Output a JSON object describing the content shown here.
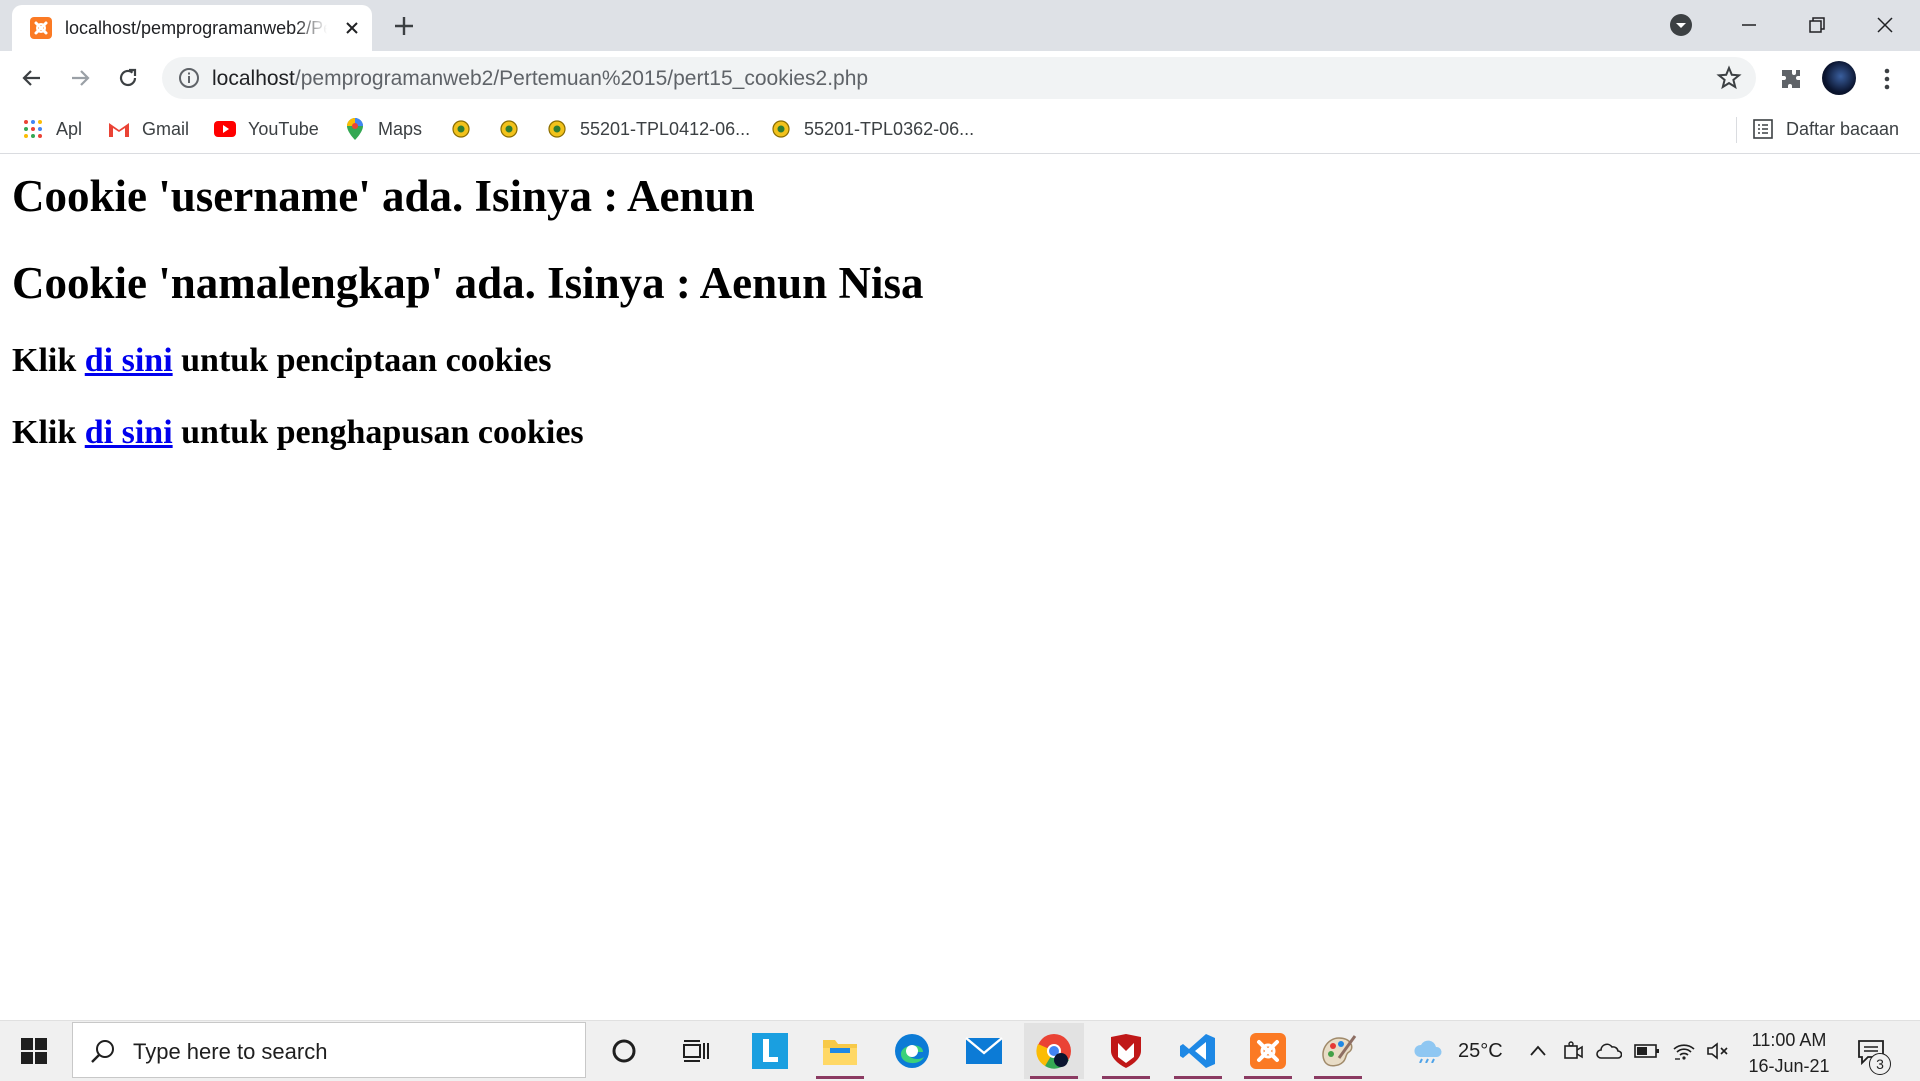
{
  "browser": {
    "tab": {
      "title": "localhost/pemprogramanweb2/Pertemuan%2015/pert15_cookies2.php"
    },
    "url": {
      "host": "localhost",
      "path": "/pemprogramanweb2/Pertemuan%2015/pert15_cookies2.php"
    },
    "bookmarks": [
      {
        "label": "Apl",
        "icon": "apps-grid-icon"
      },
      {
        "label": "Gmail",
        "icon": "gmail-icon"
      },
      {
        "label": "YouTube",
        "icon": "youtube-icon"
      },
      {
        "label": "Maps",
        "icon": "maps-pin-icon"
      },
      {
        "label": "",
        "icon": "site-logo-icon"
      },
      {
        "label": "",
        "icon": "site-logo-icon"
      },
      {
        "label": "55201-TPL0412-06...",
        "icon": "site-logo-icon"
      },
      {
        "label": "55201-TPL0362-06...",
        "icon": "site-logo-icon"
      }
    ],
    "reading_list": "Daftar bacaan"
  },
  "page": {
    "line1": "Cookie 'username' ada. Isinya : Aenun",
    "line2": "Cookie 'namalengkap' ada. Isinya : Aenun Nisa",
    "link_rows": [
      {
        "prefix": "Klik ",
        "link": "di sini",
        "suffix": " untuk penciptaan cookies"
      },
      {
        "prefix": "Klik ",
        "link": "di sini",
        "suffix": " untuk penghapusan cookies"
      }
    ]
  },
  "taskbar": {
    "search_placeholder": "Type here to search",
    "weather": "25°C",
    "time": "11:00 AM",
    "date": "16-Jun-21",
    "notification_count": "3",
    "colors": {
      "underline": "#8b3a62",
      "edge": "#0c7bd6",
      "vscode": "#1e88e5",
      "xampp": "#fb7a24",
      "mcafee": "#c01818"
    }
  }
}
